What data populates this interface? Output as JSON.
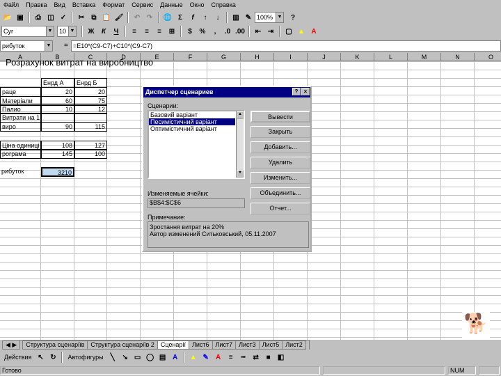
{
  "menu": [
    "Файл",
    "Правка",
    "Вид",
    "Вставка",
    "Формат",
    "Сервис",
    "Данные",
    "Окно",
    "Справка"
  ],
  "toolbar": {
    "zoom": "100%"
  },
  "format": {
    "font": "Cyr",
    "size": "10"
  },
  "formula": {
    "name_box": "рибуток",
    "content": "=E10*(C9-C7)+C10*(C9-C7)"
  },
  "columns": [
    "A",
    "B",
    "C",
    "D",
    "E",
    "F",
    "G",
    "H",
    "I",
    "J",
    "K",
    "L",
    "M",
    "N",
    "O"
  ],
  "sheet": {
    "title": "Розрахунок витрат на виробництво",
    "col_b": "Енрд А",
    "col_c": "Енрд Б",
    "rows": [
      {
        "label": "раце",
        "b": "20",
        "c": "20"
      },
      {
        "label": "Матеріали",
        "b": "60",
        "c": "75"
      },
      {
        "label": "Палио",
        "b": "10",
        "c": "12"
      },
      {
        "label": "Витрати на 1",
        "b": "",
        "c": ""
      },
      {
        "label": "виро",
        "b": "90",
        "c": "115"
      },
      {
        "label": "Ціна одиниці",
        "b": "108",
        "c": "127"
      },
      {
        "label": "рограма",
        "b": "145",
        "c": "100"
      },
      {
        "label": "рибуток",
        "b": "3210",
        "c": ""
      }
    ]
  },
  "dialog": {
    "title": "Диспетчер сценариев",
    "list_label": "Сценарии:",
    "scenarios": [
      "Базовий варіант",
      "Песимістичний варіант",
      "Оптимістичний варіант"
    ],
    "buttons": [
      "Вывести",
      "Закрыть",
      "Добавить...",
      "Удалить",
      "Изменить...",
      "Объединить...",
      "Отчет..."
    ],
    "cells_label": "Изменяемые ячейки:",
    "cells_value": "$B$4:$C$6",
    "comment_label": "Примечание:",
    "comment_lines": [
      "Зростання витрат на 20%",
      "Автор изменений Ситьковський, 05.11.2007"
    ]
  },
  "tabs": [
    "Структура сценаріїв",
    "Структура сценаріїв 2",
    "Сценарії",
    "Лист6",
    "Лист7",
    "Лист3",
    "Лист5",
    "Лист2"
  ],
  "drawing": {
    "draw": "Действия",
    "autoshapes": "Автофигуры"
  },
  "status": {
    "left": "Готово",
    "num": "NUM"
  }
}
